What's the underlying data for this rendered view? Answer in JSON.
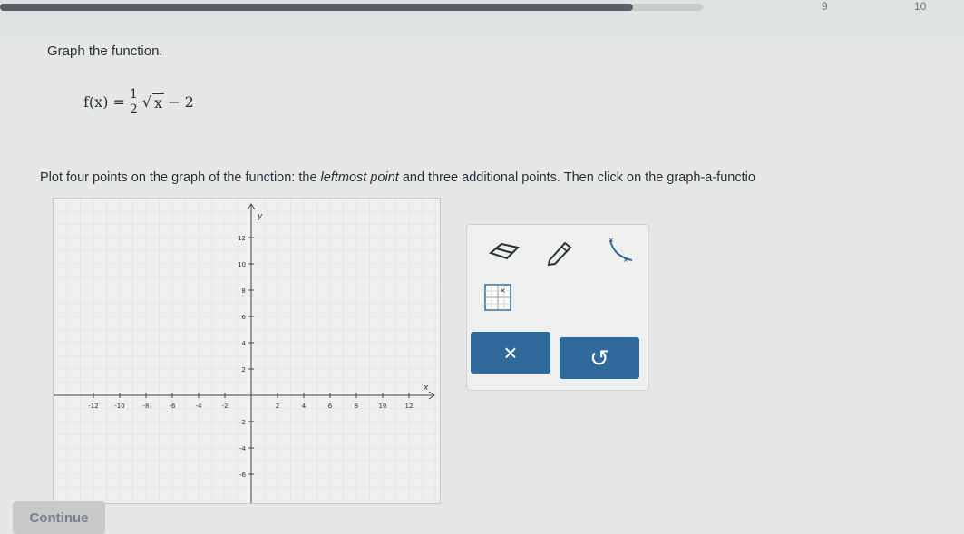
{
  "header": {
    "progress_fraction": 0.9,
    "steps": [
      "9",
      "10"
    ]
  },
  "question": {
    "prompt": "Graph the function.",
    "formula": {
      "lhs": "f(x) =",
      "coefficient_numerator": "1",
      "coefficient_denominator": "2",
      "radicand": "x",
      "constant": "− 2"
    },
    "instruction_before": "Plot four points on the graph of the function: the ",
    "instruction_emphasis": "leftmost point",
    "instruction_after": " and three additional points. Then click on the graph-a-functio"
  },
  "graph": {
    "x_axis_label": "x",
    "y_axis_label": "y",
    "x_ticks": [
      "-12",
      "-10",
      "-8",
      "-6",
      "-4",
      "-2",
      "2",
      "4",
      "6",
      "8",
      "10",
      "12"
    ],
    "y_ticks": [
      "12",
      "10",
      "8",
      "6",
      "4",
      "2",
      "-2",
      "-4",
      "-6"
    ]
  },
  "toolbox": {
    "tools": [
      "eraser-icon",
      "pencil-icon",
      "graph-a-function-icon",
      "point-grid-icon"
    ],
    "clear_label": "×",
    "undo_label": "↺"
  },
  "footer": {
    "continue_label": "Continue"
  },
  "colors": {
    "button": "#2f6a9a",
    "background": "#e6e8e8"
  }
}
